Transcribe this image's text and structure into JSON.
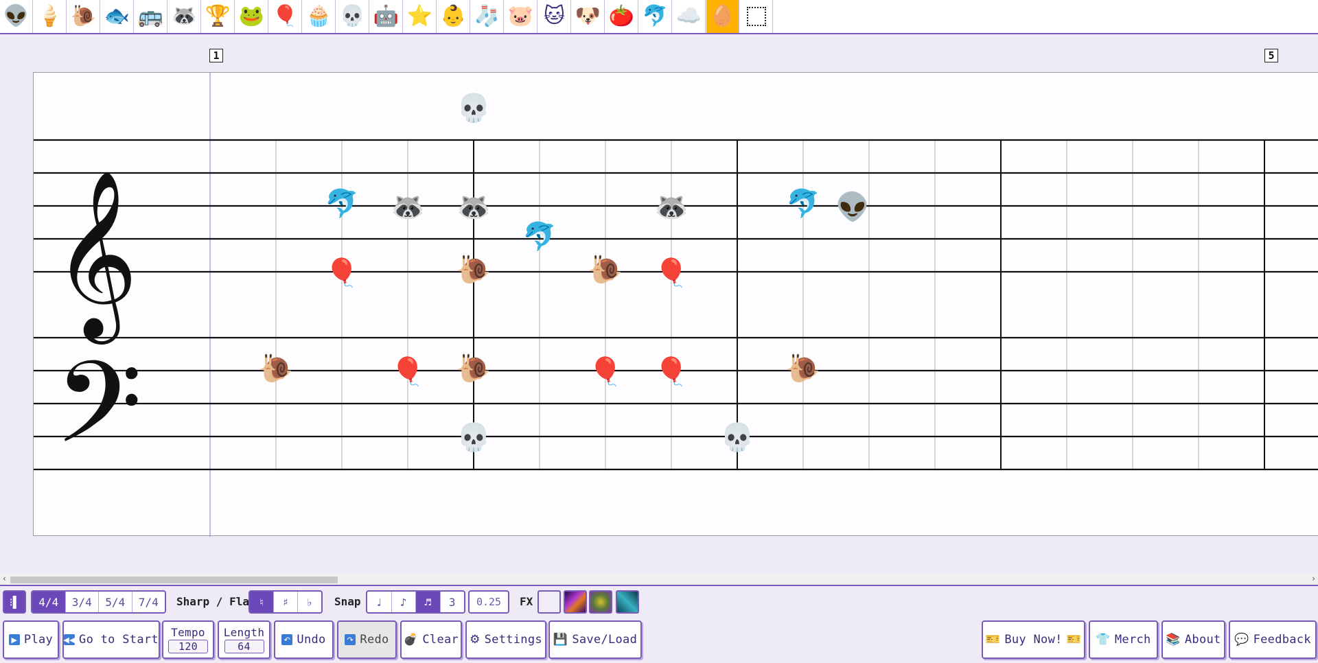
{
  "palette": [
    {
      "name": "alien-icon",
      "glyph": "👽"
    },
    {
      "name": "ice-cream-icon",
      "glyph": "🍦"
    },
    {
      "name": "snail-icon",
      "glyph": "🐌"
    },
    {
      "name": "fish-icon",
      "glyph": "🐟"
    },
    {
      "name": "school-bus-icon",
      "glyph": "🚌"
    },
    {
      "name": "raccoon-icon",
      "glyph": "🦝"
    },
    {
      "name": "trophy-icon",
      "glyph": "🏆"
    },
    {
      "name": "frog-icon",
      "glyph": "🐸"
    },
    {
      "name": "beach-ball-icon",
      "glyph": "🎈"
    },
    {
      "name": "cupcake-icon",
      "glyph": "🧁"
    },
    {
      "name": "skull-icon",
      "glyph": "💀"
    },
    {
      "name": "robot-icon",
      "glyph": "🤖"
    },
    {
      "name": "star-icon",
      "glyph": "⭐"
    },
    {
      "name": "baby-icon",
      "glyph": "👶"
    },
    {
      "name": "sock-icon",
      "glyph": "🧦"
    },
    {
      "name": "pig-icon",
      "glyph": "🐷"
    },
    {
      "name": "cat-icon",
      "glyph": "🐱"
    },
    {
      "name": "dog-icon",
      "glyph": "🐶"
    },
    {
      "name": "tomato-icon",
      "glyph": "🍅"
    },
    {
      "name": "dolphin-icon",
      "glyph": "🐬"
    },
    {
      "name": "cloud-icon",
      "glyph": "☁️"
    },
    {
      "name": "eraser-icon",
      "glyph": "🥚",
      "selected": true
    },
    {
      "name": "select-box-icon",
      "glyph": "",
      "tool": "select"
    }
  ],
  "measures": {
    "first": "1",
    "next": "5"
  },
  "notes": [
    {
      "staff": "treble",
      "beat": 3.0,
      "pos": -1,
      "glyph": "💀",
      "name": "skull-note"
    },
    {
      "staff": "treble",
      "beat": 1.0,
      "pos": 1.9,
      "glyph": "🐬",
      "name": "dolphin-note"
    },
    {
      "staff": "treble",
      "beat": 2.0,
      "pos": 2,
      "glyph": "🦝",
      "name": "raccoon-note"
    },
    {
      "staff": "treble",
      "beat": 3.0,
      "pos": 2,
      "glyph": "🦝",
      "name": "raccoon-note"
    },
    {
      "staff": "treble",
      "beat": 6.0,
      "pos": 2,
      "glyph": "🦝",
      "name": "raccoon-note"
    },
    {
      "staff": "treble",
      "beat": 8.0,
      "pos": 1.9,
      "glyph": "🐬",
      "name": "dolphin-note"
    },
    {
      "staff": "treble",
      "beat": 8.75,
      "pos": 2,
      "glyph": "👽",
      "name": "alien-note"
    },
    {
      "staff": "treble",
      "beat": 4.0,
      "pos": 2.9,
      "glyph": "🐬",
      "name": "dolphin-note"
    },
    {
      "staff": "treble",
      "beat": 1.0,
      "pos": 4,
      "glyph": "🎈",
      "name": "beach-ball-note"
    },
    {
      "staff": "treble",
      "beat": 3.0,
      "pos": 3.9,
      "glyph": "🐌",
      "name": "snail-note"
    },
    {
      "staff": "treble",
      "beat": 5.0,
      "pos": 3.9,
      "glyph": "🐌",
      "name": "snail-note"
    },
    {
      "staff": "treble",
      "beat": 6.0,
      "pos": 4,
      "glyph": "🎈",
      "name": "beach-ball-note"
    },
    {
      "staff": "bass",
      "beat": 0.0,
      "pos": 0.9,
      "glyph": "🐌",
      "name": "snail-note"
    },
    {
      "staff": "bass",
      "beat": 2.0,
      "pos": 1,
      "glyph": "🎈",
      "name": "beach-ball-note"
    },
    {
      "staff": "bass",
      "beat": 3.0,
      "pos": 0.9,
      "glyph": "🐌",
      "name": "snail-note"
    },
    {
      "staff": "bass",
      "beat": 5.0,
      "pos": 1,
      "glyph": "🎈",
      "name": "beach-ball-note"
    },
    {
      "staff": "bass",
      "beat": 6.0,
      "pos": 1,
      "glyph": "🎈",
      "name": "beach-ball-note"
    },
    {
      "staff": "bass",
      "beat": 8.0,
      "pos": 0.9,
      "glyph": "🐌",
      "name": "snail-note"
    },
    {
      "staff": "bass",
      "beat": 3.0,
      "pos": 3,
      "glyph": "💀",
      "name": "skull-note"
    },
    {
      "staff": "bass",
      "beat": 7.0,
      "pos": 3,
      "glyph": "💀",
      "name": "skull-note"
    }
  ],
  "toolbar": {
    "time_signatures": [
      "4/4",
      "3/4",
      "5/4",
      "7/4"
    ],
    "time_active": 0,
    "sharp_flat_label": "Sharp / Flat",
    "accidentals": [
      "♮",
      "♯",
      "♭"
    ],
    "accidental_active": 0,
    "snap_label": "Snap",
    "snaps": [
      "♩",
      "♪",
      "♬",
      "3"
    ],
    "snap_active": 2,
    "snap_value": "0.25",
    "fx_label": "FX",
    "play": "Play",
    "go_to_start": "Go to Start",
    "tempo_label": "Tempo",
    "tempo_value": "120",
    "length_label": "Length",
    "length_value": "64",
    "undo": "Undo",
    "redo": "Redo",
    "clear": "Clear",
    "settings": "Settings",
    "save_load": "Save/Load",
    "buy_now": "Buy Now!",
    "merch": "Merch",
    "about": "About",
    "feedback": "Feedback"
  },
  "colors": {
    "accent": "#7a5ab8",
    "active": "#6a48b8",
    "selected_tool": "#ffb300"
  }
}
